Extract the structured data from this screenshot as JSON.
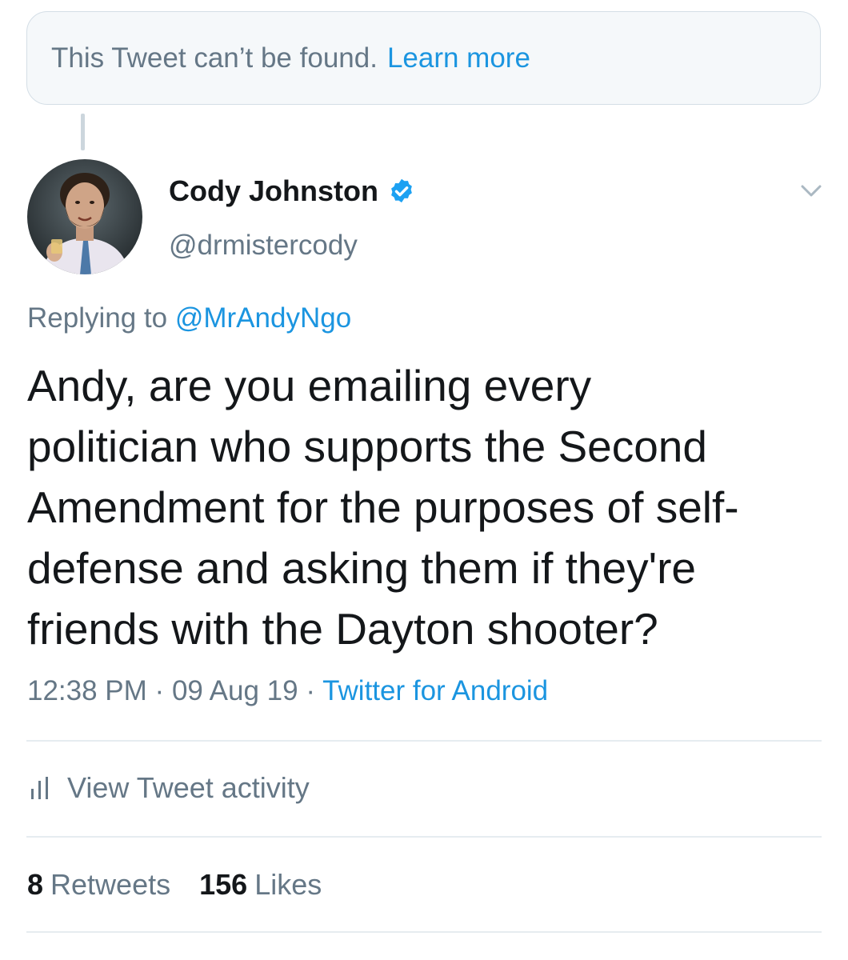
{
  "unavailable_notice": {
    "text": "This Tweet can’t be found.",
    "link": "Learn more"
  },
  "author": {
    "display_name": "Cody Johnston",
    "handle": "@drmistercody",
    "verified": true,
    "avatar_icon": "avatar-photo"
  },
  "reply": {
    "prefix": "Replying to",
    "mention": "@MrAndyNgo"
  },
  "tweet": {
    "text": "Andy, are you emailing every\npolitician who supports the Second\nAmendment for the purposes of self-\ndefense and asking them if they're\nfriends with the Dayton shooter?",
    "time": "12:38 PM",
    "date": "09 Aug 19",
    "source": "Twitter for Android",
    "separator": "·"
  },
  "activity": {
    "icon": "bar-chart-icon",
    "label": "View Tweet activity"
  },
  "stats": {
    "retweets_count": "8",
    "retweets_label": "Retweets",
    "likes_count": "156",
    "likes_label": "Likes"
  },
  "colors": {
    "link": "#1b95e0",
    "muted": "#657786",
    "verified": "#1da1f2",
    "divider": "#e6ecf0"
  }
}
